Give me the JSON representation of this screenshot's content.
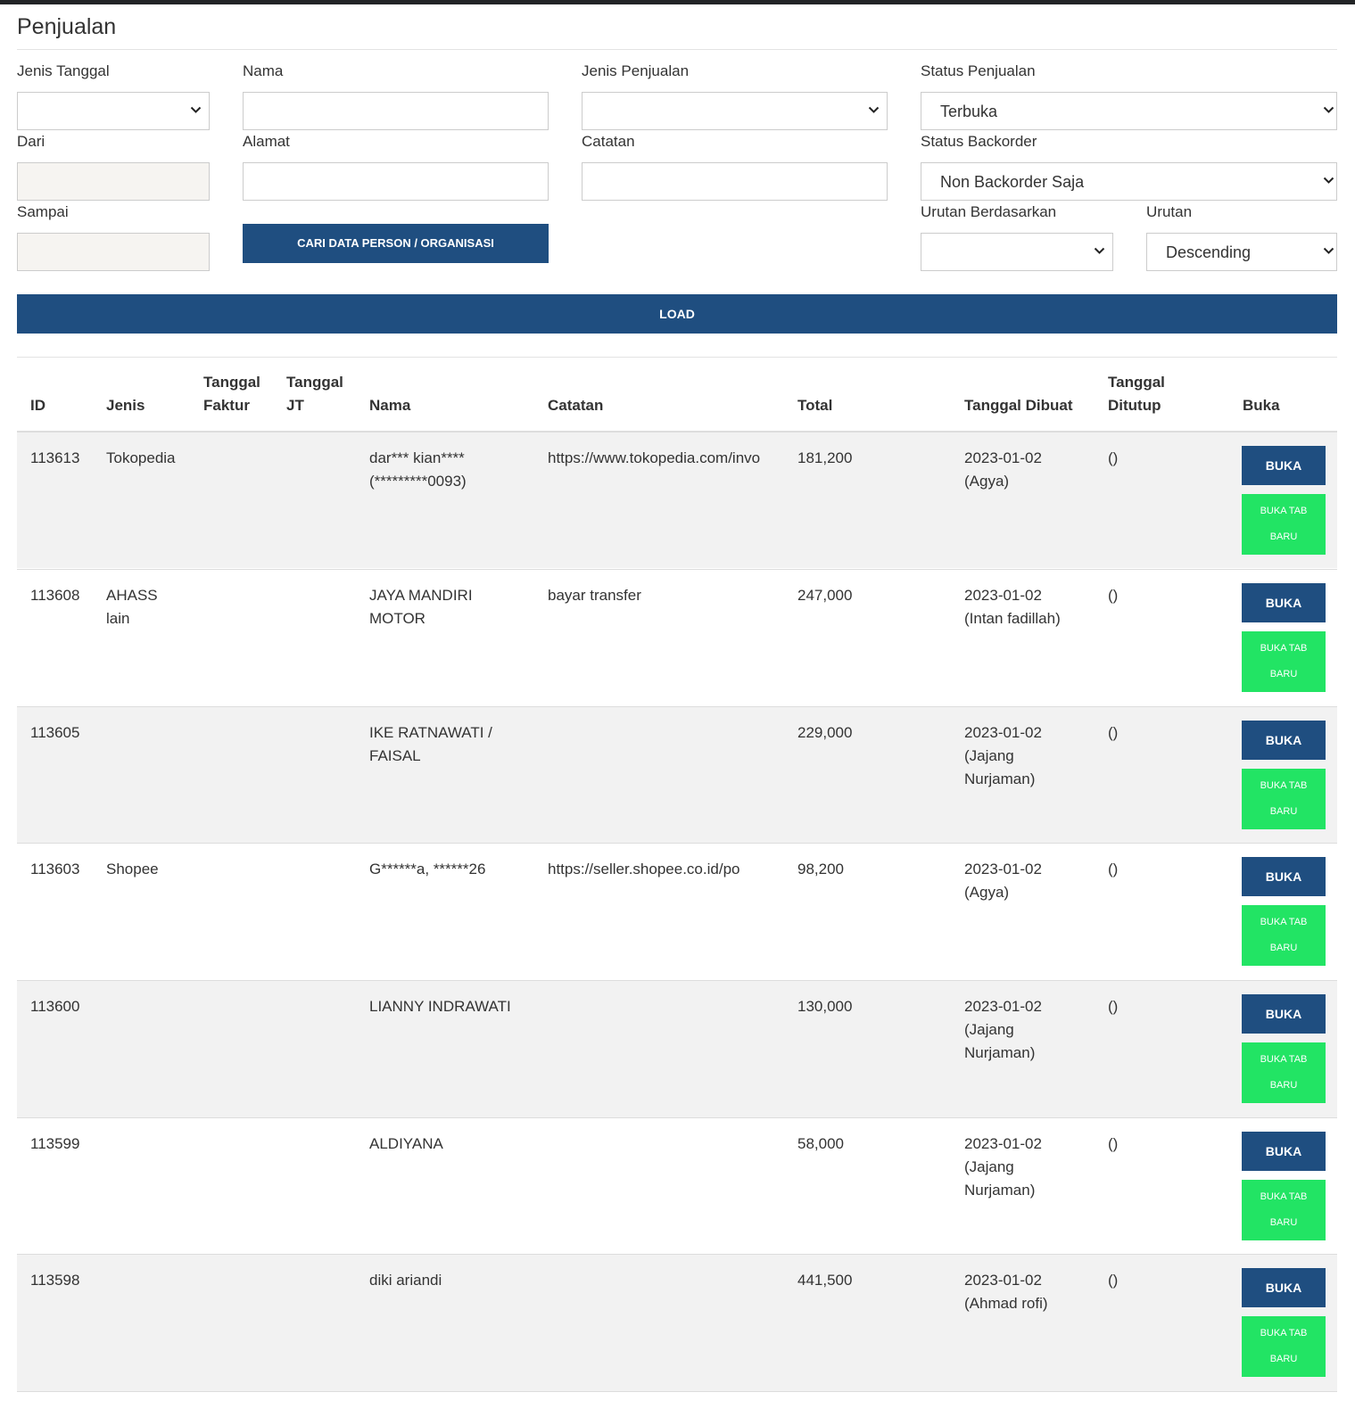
{
  "page": {
    "title": "Penjualan"
  },
  "form": {
    "jenis_tanggal": {
      "label": "Jenis Tanggal",
      "value": ""
    },
    "dari": {
      "label": "Dari",
      "value": ""
    },
    "sampai": {
      "label": "Sampai",
      "value": ""
    },
    "nama": {
      "label": "Nama",
      "value": ""
    },
    "alamat": {
      "label": "Alamat",
      "value": ""
    },
    "cari_button": "CARI DATA PERSON / ORGANISASI",
    "jenis_penjualan": {
      "label": "Jenis Penjualan",
      "value": ""
    },
    "catatan": {
      "label": "Catatan",
      "value": ""
    },
    "status_penjualan": {
      "label": "Status Penjualan",
      "value": "Terbuka"
    },
    "status_backorder": {
      "label": "Status Backorder",
      "value": "Non Backorder Saja"
    },
    "urutan_berdasarkan": {
      "label": "Urutan Berdasarkan",
      "value": ""
    },
    "urutan": {
      "label": "Urutan",
      "value": "Descending"
    },
    "load_button": "LOAD"
  },
  "table": {
    "headers": {
      "id": "ID",
      "jenis": "Jenis",
      "tanggal_faktur": "Tanggal\nFaktur",
      "tanggal_jt": "Tanggal\nJT",
      "nama": "Nama",
      "catatan": "Catatan",
      "total": "Total",
      "tanggal_dibuat": "Tanggal Dibuat",
      "tanggal_ditutup": "Tanggal\nDitutup",
      "buka": "Buka"
    },
    "buka_label": "BUKA",
    "buka_tab_label_1": "BUKA TAB",
    "buka_tab_label_2": "BARU",
    "rows": [
      {
        "id": "113613",
        "jenis": "Tokopedia",
        "tanggal_faktur": "",
        "tanggal_jt": "",
        "nama": "dar*** kian****\n(*********0093)",
        "catatan": "https://www.tokopedia.com/invo",
        "total": "181,200",
        "tanggal_dibuat": "2023-01-02\n(Agya)",
        "tanggal_ditutup": "()"
      },
      {
        "id": "113608",
        "jenis": "AHASS\nlain",
        "tanggal_faktur": "",
        "tanggal_jt": "",
        "nama": "JAYA MANDIRI\nMOTOR",
        "catatan": "bayar transfer",
        "total": "247,000",
        "tanggal_dibuat": "2023-01-02\n(Intan fadillah)",
        "tanggal_ditutup": "()"
      },
      {
        "id": "113605",
        "jenis": "",
        "tanggal_faktur": "",
        "tanggal_jt": "",
        "nama": "IKE RATNAWATI /\nFAISAL",
        "catatan": "",
        "total": "229,000",
        "tanggal_dibuat": "2023-01-02\n(Jajang\nNurjaman)",
        "tanggal_ditutup": "()"
      },
      {
        "id": "113603",
        "jenis": "Shopee",
        "tanggal_faktur": "",
        "tanggal_jt": "",
        "nama": "G******a, ******26",
        "catatan": "https://seller.shopee.co.id/po",
        "total": "98,200",
        "tanggal_dibuat": "2023-01-02\n(Agya)",
        "tanggal_ditutup": "()"
      },
      {
        "id": "113600",
        "jenis": "",
        "tanggal_faktur": "",
        "tanggal_jt": "",
        "nama": "LIANNY INDRAWATI",
        "catatan": "",
        "total": "130,000",
        "tanggal_dibuat": "2023-01-02\n(Jajang\nNurjaman)",
        "tanggal_ditutup": "()"
      },
      {
        "id": "113599",
        "jenis": "",
        "tanggal_faktur": "",
        "tanggal_jt": "",
        "nama": "ALDIYANA",
        "catatan": "",
        "total": "58,000",
        "tanggal_dibuat": "2023-01-02\n(Jajang\nNurjaman)",
        "tanggal_ditutup": "()"
      },
      {
        "id": "113598",
        "jenis": "",
        "tanggal_faktur": "",
        "tanggal_jt": "",
        "nama": "diki ariandi",
        "catatan": "",
        "total": "441,500",
        "tanggal_dibuat": "2023-01-02\n(Ahmad rofi)",
        "tanggal_ditutup": "()"
      }
    ]
  },
  "colors": {
    "primary": "#1f4e80",
    "success": "#22e464",
    "row_stripe": "#f2f2f2",
    "topbar": "#222426"
  },
  "icons": {
    "select_arrow": "chevron-down-icon"
  }
}
